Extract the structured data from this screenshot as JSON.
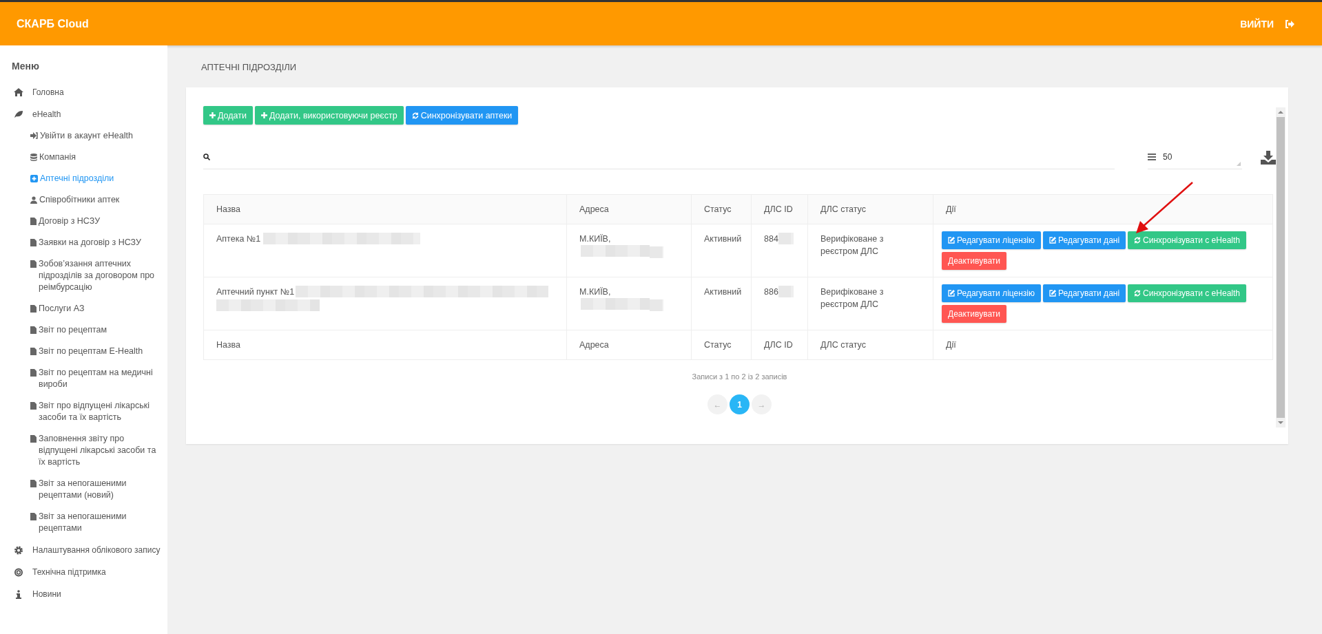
{
  "header": {
    "brand": "СКАРБ Cloud",
    "logout": "ВИЙТИ"
  },
  "sidebar": {
    "title": "Меню",
    "items": [
      {
        "label": "Головна",
        "kind": "home",
        "selected": false
      },
      {
        "label": "eHealth",
        "kind": "leaf",
        "selected": false,
        "children": [
          {
            "label": "Увійти в акаунт eHealth",
            "kind": "login",
            "selected": false
          },
          {
            "label": "Компанія",
            "kind": "database",
            "selected": false
          },
          {
            "label": "Аптечні підрозділи",
            "kind": "plus",
            "selected": true
          },
          {
            "label": "Співробітники аптек",
            "kind": "user",
            "selected": false
          },
          {
            "label": "Договір з НСЗУ",
            "kind": "file",
            "selected": false
          },
          {
            "label": "Заявки на договір з НСЗУ",
            "kind": "file",
            "selected": false
          },
          {
            "label": "Зобов’язання аптечних підрозділів за договором про реімбурсацію",
            "kind": "file",
            "selected": false
          },
          {
            "label": "Послуги АЗ",
            "kind": "file",
            "selected": false
          },
          {
            "label": "Звіт по рецептам",
            "kind": "file",
            "selected": false
          },
          {
            "label": "Звіт по рецептам E-Health",
            "kind": "file",
            "selected": false
          },
          {
            "label": "Звіт по рецептам на медичні вироби",
            "kind": "file",
            "selected": false
          },
          {
            "label": "Звіт про відпущені лікарські засоби та їх вартість",
            "kind": "file",
            "selected": false
          },
          {
            "label": "Заповнення звіту про відпущені лікарські засоби та їх вартість",
            "kind": "file",
            "selected": false
          },
          {
            "label": "Звіт за непогашеними рецептами (новий)",
            "kind": "file",
            "selected": false
          },
          {
            "label": "Звіт за непогашеними рецептами",
            "kind": "file",
            "selected": false
          }
        ]
      },
      {
        "label": "Налаштування облікового запису",
        "kind": "gear",
        "selected": false
      },
      {
        "label": "Технічна підтримка",
        "kind": "lifebuoy",
        "selected": false
      },
      {
        "label": "Новини",
        "kind": "info",
        "selected": false
      }
    ]
  },
  "page_title": "АПТЕЧНІ ПІДРОЗДІЛИ",
  "toolbar": [
    {
      "label": "Додати",
      "kind": "add"
    },
    {
      "label": "Додати, використовуючи реєстр",
      "kind": "add"
    },
    {
      "label": "Синхронізувати аптеки",
      "kind": "sync"
    }
  ],
  "page_size": {
    "value": "50"
  },
  "table": {
    "columns": [
      "Назва",
      "Адреса",
      "Статус",
      "ДЛС ID",
      "ДЛС статус",
      "Дії"
    ],
    "rows": [
      {
        "name": "Аптека №1",
        "address": "М.КИЇВ,",
        "status": "Активний",
        "dls_id": "884",
        "dls_status": "Верифіковане з реєстром ДЛС",
        "actions": [
          {
            "label": "Редагувати ліцензію",
            "kind": "edit"
          },
          {
            "label": "Редагувати дані",
            "kind": "edit"
          },
          {
            "label": "Синхронізувати с eHealth",
            "kind": "sync"
          },
          {
            "label": "Деактивувати",
            "kind": "deactivate"
          }
        ]
      },
      {
        "name": "Аптечний пункт №1",
        "address": "М.КИЇВ,",
        "status": "Активний",
        "dls_id": "886",
        "dls_status": "Верифіковане з реєстром ДЛС",
        "actions": [
          {
            "label": "Редагувати ліцензію",
            "kind": "edit"
          },
          {
            "label": "Редагувати дані",
            "kind": "edit"
          },
          {
            "label": "Синхронізувати с eHealth",
            "kind": "sync"
          },
          {
            "label": "Деактивувати",
            "kind": "deactivate"
          }
        ]
      }
    ],
    "footer": [
      "Назва",
      "Адреса",
      "Статус",
      "ДЛС ID",
      "ДЛС статус",
      "Дії"
    ]
  },
  "info": "Записи з 1 по 2 із 2 записів",
  "pagination": {
    "prev": "←",
    "next": "→",
    "pages": [
      {
        "label": "1",
        "selected": true
      }
    ]
  }
}
